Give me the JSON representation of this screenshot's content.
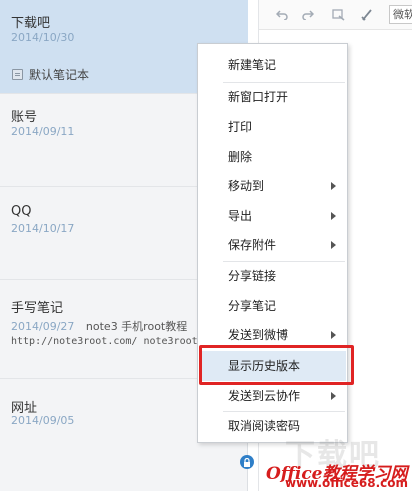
{
  "notes": [
    {
      "title": "下载吧",
      "date": "2014/10/30",
      "notebook": "默认笔记本",
      "selected": true
    },
    {
      "title": "账号",
      "date": "2014/09/11"
    },
    {
      "title": "QQ",
      "date": "2014/10/17"
    },
    {
      "title": "手写笔记",
      "date": "2014/09/27",
      "preview": "note3 手机root教程",
      "snippet": "http://note3root.com/ note3root"
    },
    {
      "title": "网址",
      "date": "2014/09/05"
    }
  ],
  "toolbar": {
    "icons": [
      "undo-icon",
      "redo-icon",
      "format-painter-icon",
      "clear-format-icon"
    ],
    "font_value": "微软"
  },
  "context_menu": {
    "items": [
      {
        "label": "新建笔记",
        "submenu": false
      },
      {
        "label": "新窗口打开",
        "submenu": false
      },
      {
        "label": "打印",
        "submenu": false
      },
      {
        "label": "删除",
        "submenu": false
      },
      {
        "label": "移动到",
        "submenu": true
      },
      {
        "label": "导出",
        "submenu": true
      },
      {
        "label": "保存附件",
        "submenu": true
      },
      {
        "label": "分享链接",
        "submenu": false
      },
      {
        "label": "分享笔记",
        "submenu": false
      },
      {
        "label": "发送到微博",
        "submenu": true
      },
      {
        "label": "显示历史版本",
        "submenu": false,
        "highlighted": true
      },
      {
        "label": "发送到云协作",
        "submenu": true
      },
      {
        "label": "取消阅读密码",
        "submenu": false
      }
    ]
  },
  "watermark": {
    "big": "下载吧",
    "brand": "Office教程学习网",
    "url": "www.office68.com"
  },
  "colors": {
    "selected_row": "#cfe0f1",
    "date_text": "#8aa7c4",
    "highlight_box": "#e02424",
    "watermark_red": "#d61d1d"
  }
}
